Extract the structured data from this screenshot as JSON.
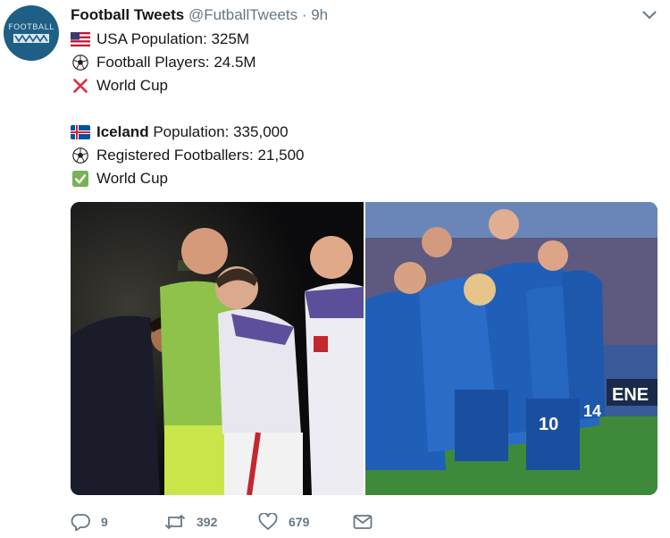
{
  "author": {
    "name": "Football Tweets",
    "handle": "@FutballTweets",
    "separator": "·",
    "time": "9h",
    "avatar_text": "FOOTBALL"
  },
  "tweet": {
    "lines": [
      {
        "icon": "usa-flag-icon",
        "text": "USA Population: 325M"
      },
      {
        "icon": "soccer-ball-icon",
        "text": "Football Players: 24.5M"
      },
      {
        "icon": "red-cross-mark-icon",
        "text": "World Cup"
      },
      {
        "icon": "iceland-flag-icon",
        "bold": "Iceland",
        "text": " Population: 335,000"
      },
      {
        "icon": "soccer-ball-icon",
        "text": "Registered Footballers: 21,500"
      },
      {
        "icon": "green-check-mark-icon",
        "text": "World Cup"
      }
    ]
  },
  "media": {
    "right_photo_banner": "ENE",
    "jersey_numbers": [
      "10",
      "14"
    ]
  },
  "actions": {
    "replies": "9",
    "retweets": "392",
    "likes": "679"
  },
  "colors": {
    "name": "#14171a",
    "meta": "#657786",
    "avatar": "#1f5f86",
    "iceland_kit": "#1f5fb8",
    "usa_kit": "#6a5ea8"
  }
}
